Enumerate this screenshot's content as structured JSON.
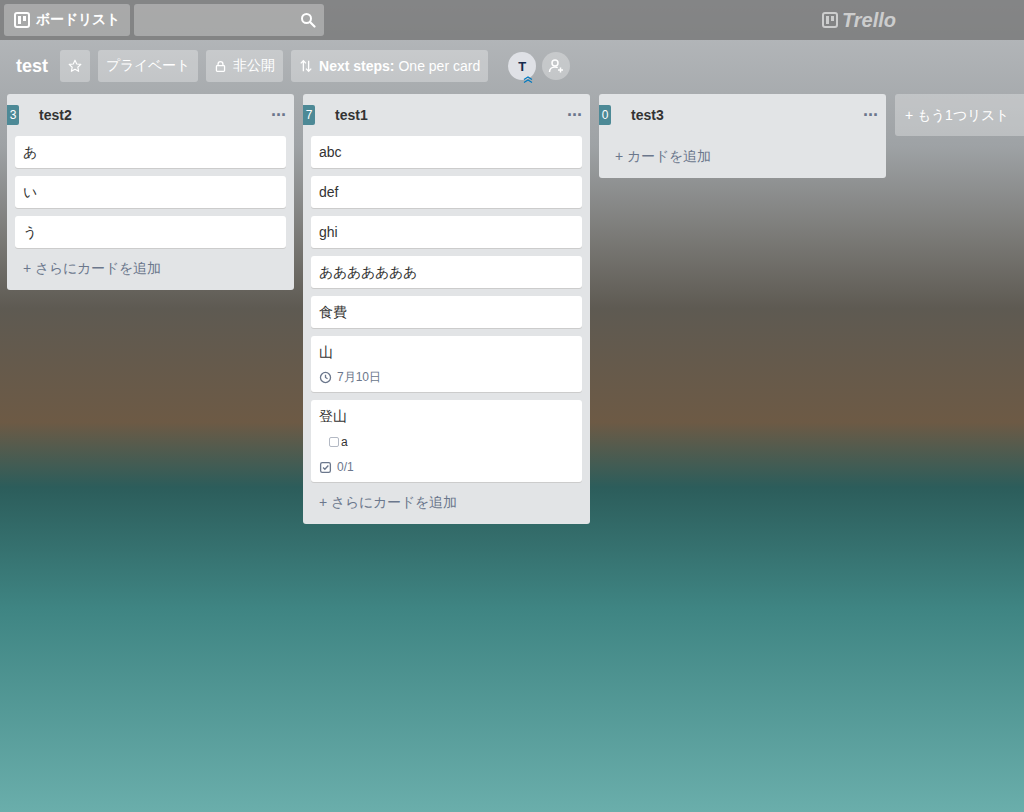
{
  "header": {
    "boards_button": "ボードリスト",
    "logo": "Trello"
  },
  "board": {
    "title": "test",
    "starred": false,
    "visibility": "プライベート",
    "privacy": "非公開",
    "next_steps": {
      "label": "Next steps:",
      "value": "One per card"
    },
    "members": [
      {
        "initial": "T",
        "admin": true
      }
    ]
  },
  "lists": [
    {
      "title": "test2",
      "count": "3",
      "menu": "···",
      "add_label": "+ さらにカードを追加",
      "cards": [
        {
          "kind": "plain",
          "title": "あ"
        },
        {
          "kind": "plain",
          "title": "い"
        },
        {
          "kind": "plain",
          "title": "う"
        }
      ]
    },
    {
      "title": "test1",
      "count": "7",
      "menu": "···",
      "add_label": "+ さらにカードを追加",
      "cards": [
        {
          "kind": "plain",
          "title": "abc"
        },
        {
          "kind": "plain",
          "title": "def"
        },
        {
          "kind": "plain",
          "title": "ghi"
        },
        {
          "kind": "plain",
          "title": "あああああああ"
        },
        {
          "kind": "plain",
          "title": "食費"
        },
        {
          "kind": "due",
          "title": "山",
          "due": "7月10日"
        },
        {
          "kind": "checklist",
          "title": "登山",
          "items": [
            {
              "label": "a",
              "checked": false
            }
          ],
          "progress": "0/1"
        }
      ]
    },
    {
      "title": "test3",
      "count": "0",
      "menu": "···",
      "add_label": "+ カードを追加",
      "cards": []
    }
  ],
  "add_list": "+ もう1つリスト"
}
